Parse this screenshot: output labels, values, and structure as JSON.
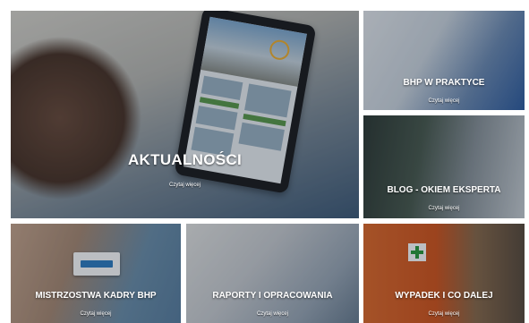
{
  "tiles": {
    "main": {
      "title": "AKTUALNOŚCI",
      "more": "Czytaj więcej"
    },
    "bhp": {
      "title": "BHP W PRAKTYCE",
      "more": "Czytaj więcej"
    },
    "blog": {
      "title": "BLOG - OKIEM EKSPERTA",
      "more": "Czytaj więcej"
    },
    "mist": {
      "title": "MISTRZOSTWA KADRY BHP",
      "more": "Czytaj więcej"
    },
    "rap": {
      "title": "RAPORTY I OPRACOWANIA",
      "more": "Czytaj więcej"
    },
    "wyp": {
      "title": "WYPADEK I CO DALEJ",
      "more": "Czytaj więcej"
    }
  },
  "icons": {
    "tablet": "tablet-image",
    "card": "id-card-image",
    "first_aid": "first-aid-kit-image"
  },
  "colors": {
    "title_text": "#ffffff",
    "first_aid_orange": "#e06a2a",
    "first_aid_green": "#2a9a3a"
  }
}
